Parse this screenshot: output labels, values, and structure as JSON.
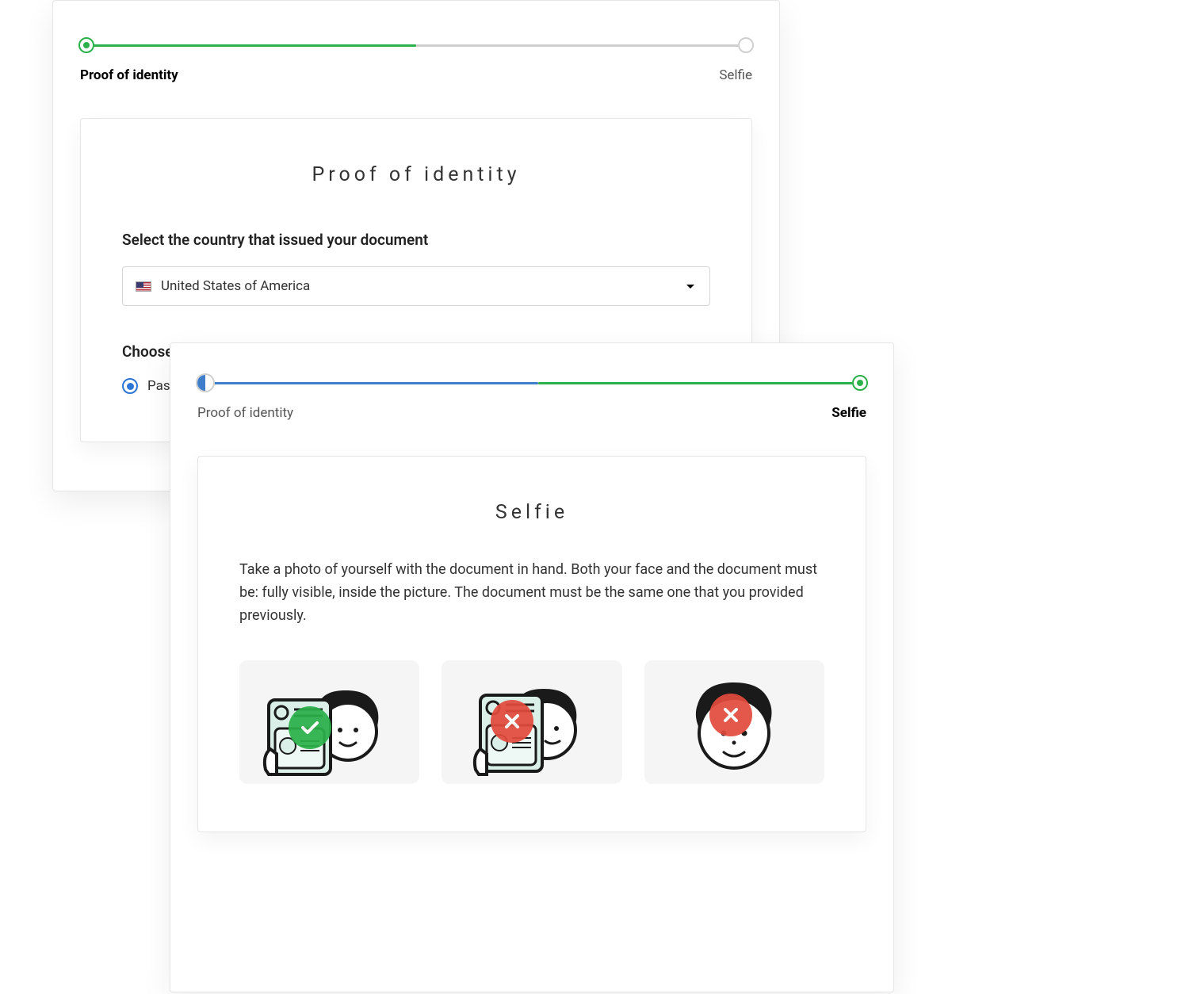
{
  "colors": {
    "green": "#2bb04a",
    "blue": "#3f7ecb",
    "grey": "#cfcfcf",
    "red": "#e24b3e"
  },
  "panel_a": {
    "progress": {
      "step1_label": "Proof of identity",
      "step2_label": "Selfie",
      "active_step": 1,
      "fill_percent": 50,
      "fill_color": "#2bb04a",
      "node1": {
        "ring": "#2bb04a",
        "dot": "#2bb04a"
      },
      "node2": {
        "ring": "#cfcfcf",
        "dot": null
      }
    },
    "card": {
      "title": "Proof of identity",
      "country_label": "Select the country that issued your document",
      "country_value": "United States of America",
      "id_type_label": "Choose your ID type",
      "id_option_1": "Passport"
    }
  },
  "panel_b": {
    "progress": {
      "step1_label": "Proof of identity",
      "step2_label": "Selfie",
      "active_step": 2,
      "fill_percent": 100,
      "segment1_color": "#3f7ecb",
      "segment2_color": "#2bb04a",
      "node1": {
        "ring": "#3f7ecb",
        "fill": "half-blue"
      },
      "node2": {
        "ring": "#2bb04a",
        "dot": "#2bb04a"
      }
    },
    "card": {
      "title": "Selfie",
      "instructions": "Take a photo of yourself with the document in hand. Both your face and the document must be: fully visible, inside the picture. The document must be the same one that you provided previously.",
      "examples": [
        {
          "status": "good",
          "badge": "check",
          "desc": "face-and-id-visible"
        },
        {
          "status": "bad",
          "badge": "x",
          "desc": "id-covers-face"
        },
        {
          "status": "bad",
          "badge": "x",
          "desc": "no-document"
        }
      ]
    }
  }
}
